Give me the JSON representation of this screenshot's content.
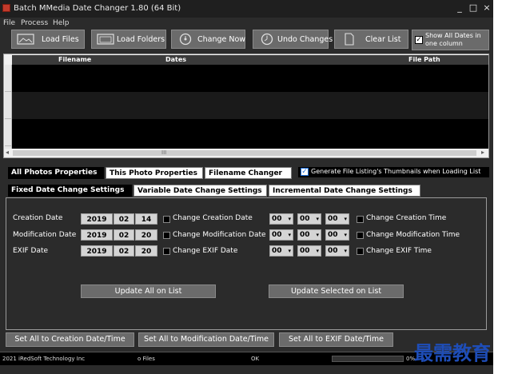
{
  "window": {
    "title": "Batch MMedia Date Changer 1.80 (64 Bit)",
    "controls": [
      "_",
      "□",
      "×"
    ]
  },
  "menu": [
    "File",
    "Process",
    "Help"
  ],
  "toolbar": {
    "load_files": "Load Files",
    "load_folders": "Load Folders",
    "change_now": "Change Now",
    "undo_changes": "Undo Changes",
    "clear_list": "Clear List",
    "show_all_dates_line1": "Show All Dates in",
    "show_all_dates_line2": "one column",
    "show_all_dates_checked": true
  },
  "grid": {
    "columns": [
      "Filename",
      "Dates",
      "File Path"
    ],
    "rows": [],
    "grip": "III"
  },
  "property_tabs": [
    "All Photos Properties",
    "This Photo Properties",
    "Filename Changer"
  ],
  "generate_thumbnails": {
    "label": "Generate File Listing's Thumbnails when Loading List",
    "checked": true
  },
  "settings_tabs": [
    "Fixed Date Change Settings",
    "Variable Date Change Settings",
    "Incremental Date Change Settings"
  ],
  "date_rows": [
    {
      "label": "Creation Date",
      "year": "2019",
      "month": "02",
      "day": "14",
      "change_date": "Change Creation Date",
      "hh": "00",
      "mm": "00",
      "ss": "00",
      "change_time": "Change Creation Time"
    },
    {
      "label": "Modification Date",
      "year": "2019",
      "month": "02",
      "day": "20",
      "change_date": "Change Modification Date",
      "hh": "00",
      "mm": "00",
      "ss": "00",
      "change_time": "Change Modification Time"
    },
    {
      "label": "EXIF Date",
      "year": "2019",
      "month": "02",
      "day": "20",
      "change_date": "Change EXIF Date",
      "hh": "00",
      "mm": "00",
      "ss": "00",
      "change_time": "Change EXIF Time"
    }
  ],
  "panel_buttons": {
    "update_all": "Update All on List",
    "update_selected": "Update Selected on List"
  },
  "bottom_buttons": {
    "set_creation": "Set All to Creation Date/Time",
    "set_modification": "Set All to Modification Date/Time",
    "set_exif": "Set All to EXIF Date/Time"
  },
  "status": {
    "copyright": "2021 iRedSoft Technology Inc",
    "files": "o Files",
    "state": "OK",
    "percent": "0%",
    "progress": 0
  },
  "watermark": "最需教育",
  "colors": {
    "window_bg": "#2b2b2b",
    "button_bg": "#6b6b6b",
    "watermark": "#1e4db7",
    "checkbox_accent": "#1e6fd9"
  }
}
